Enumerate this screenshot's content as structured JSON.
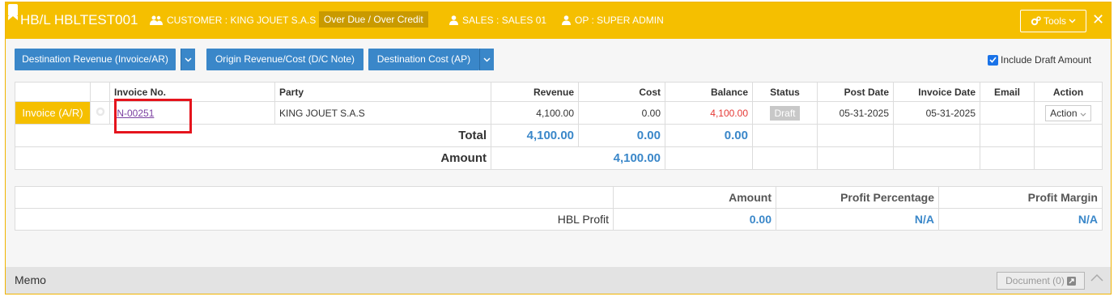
{
  "header": {
    "hbl_title": "HB/L HBLTEST001",
    "customer": "CUSTOMER : KING JOUET S.A.S",
    "credit_badge": "Over Due / Over Credit",
    "sales": "SALES : SALES 01",
    "op": "OP : SUPER ADMIN",
    "tools_label": "Tools",
    "close_glyph": "✕"
  },
  "toolbar": {
    "dest_revenue": "Destination Revenue (Invoice/AR)",
    "origin_revenue": "Origin Revenue/Cost (D/C Note)",
    "dest_cost": "Destination Cost (AP)",
    "include_draft": "Include Draft Amount",
    "include_draft_checked": true
  },
  "invoice_table": {
    "columns": [
      "",
      "",
      "Invoice No.",
      "Party",
      "Revenue",
      "Cost",
      "Balance",
      "Status",
      "Post Date",
      "Invoice Date",
      "Email",
      "Action"
    ],
    "rows": [
      {
        "type": "Invoice (A/R)",
        "invoice_no": "IN-00251",
        "party": "KING JOUET S.A.S",
        "revenue": "4,100.00",
        "cost": "0.00",
        "balance": "4,100.00",
        "status": "Draft",
        "post_date": "05-31-2025",
        "invoice_date": "05-31-2025",
        "email": "",
        "action": "Action"
      }
    ],
    "total_label": "Total",
    "total_revenue": "4,100.00",
    "total_cost": "0.00",
    "total_balance": "0.00",
    "amount_label": "Amount",
    "amount_value": "4,100.00"
  },
  "profit_table": {
    "headers": [
      "Amount",
      "Profit Percentage",
      "Profit Margin"
    ],
    "row_label": "HBL Profit",
    "amount": "0.00",
    "percentage": "N/A",
    "margin": "N/A"
  },
  "memo": {
    "title": "Memo",
    "document_label": "Document (0)"
  },
  "colors": {
    "header_bg": "#f5bf00",
    "button_blue": "#3a87c9",
    "highlight_red": "#e5141d"
  }
}
